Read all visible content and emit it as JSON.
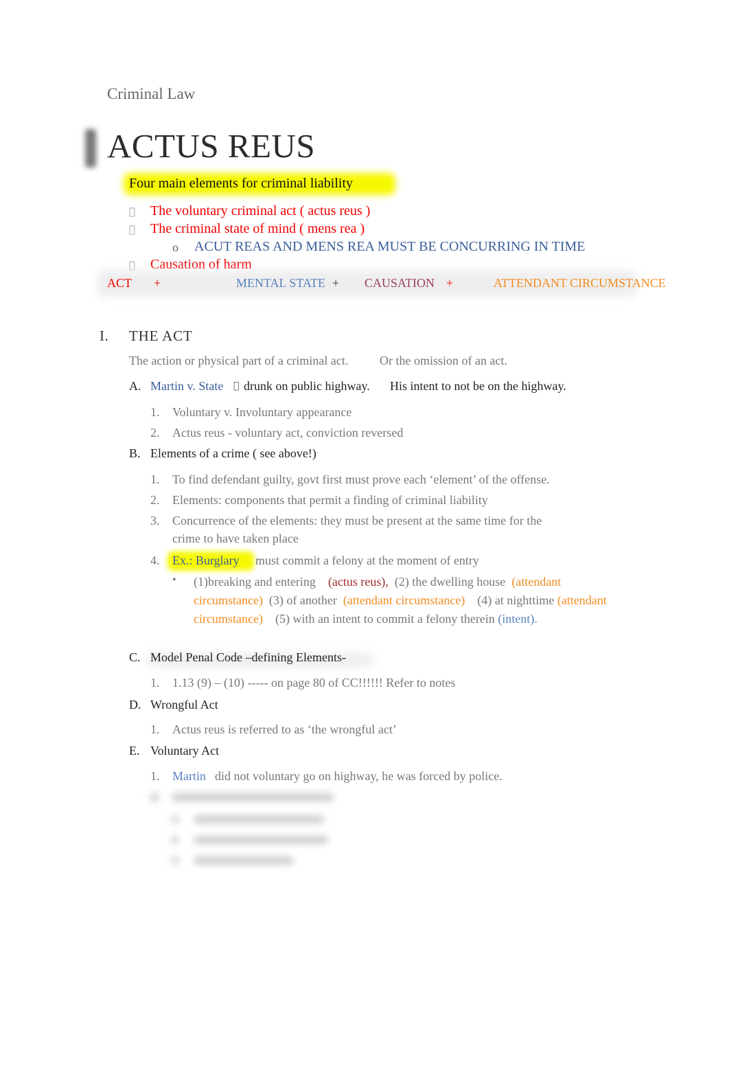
{
  "document": {
    "header": "Criminal Law",
    "title": "ACTUS REUS",
    "highlight_heading": "Four main elements for criminal liability",
    "elements": [
      {
        "bullet": "",
        "text": "The voluntary criminal act (   actus reus )"
      },
      {
        "bullet": "",
        "text": "The criminal state of mind (   mens rea )"
      },
      {
        "bullet": "",
        "text": "Causation of harm"
      }
    ],
    "sub_note": {
      "bullet": "o",
      "text": "ACUT REAS AND MENS REA MUST BE CONCURRING IN TIME"
    },
    "equation": {
      "act": "ACT",
      "plus1": "+",
      "mental_state": "MENTAL STATE",
      "plus2": "+",
      "causation": "CAUSATION",
      "plus3": "+",
      "attendant": "ATTENDANT CIRCUMSTANCE"
    },
    "section_I": {
      "numeral": "I.",
      "title": "THE ACT",
      "intro_a": "The action or physical part of a criminal act.",
      "intro_b": "Or the omission of an act.",
      "A": {
        "letter": "A.",
        "case": "Martin v. State",
        "arrow": "",
        "text_a": "drunk on public highway.",
        "text_b": "His intent to not be on the highway.",
        "items": [
          {
            "num": "1.",
            "text": "Voluntary v. Involuntary appearance"
          },
          {
            "num": "2.",
            "text": "Actus reus - voluntary act, conviction reversed"
          }
        ]
      },
      "B": {
        "letter": "B.",
        "title": "Elements of a crime ( see above!)",
        "items": [
          {
            "num": "1.",
            "text": "To find defendant guilty, govt first must prove each ‘element’ of the offense."
          },
          {
            "num": "2.",
            "text": "Elements: components that permit a finding of criminal liability"
          },
          {
            "num": "3.",
            "text_line1": "Concurrence of the elements: they must be present at the same time for the",
            "text_line2": "crime to have taken place"
          },
          {
            "num": "4.",
            "label": "Ex.: Burglary",
            "text": "must commit a felony at the moment of entry"
          }
        ],
        "burglary_bullet": {
          "bullet": "•",
          "p1": "(1)breaking and entering",
          "p1_tag": "(actus reus),",
          "p2": "(2) the dwelling house",
          "p2_tag": "(attendant circumstance)",
          "p3": "(3) of another",
          "p3_tag": "(attendant circumstance)",
          "p4": "(4) at nighttime",
          "p4_tag": "(attendant circumstance)",
          "p5": "(5) with an intent to commit a felony therein",
          "p5_tag": "(intent)."
        }
      },
      "C": {
        "letter": "C.",
        "title": "Model Penal Code –defining Elements-",
        "items": [
          {
            "num": "1.",
            "text": "1.13 (9) – (10) ----- on page 80 of CC!!!!!! Refer to notes"
          }
        ]
      },
      "D": {
        "letter": "D.",
        "title": "Wrongful Act",
        "items": [
          {
            "num": "1.",
            "text": "Actus reus is referred to as ‘the wrongful act’"
          }
        ]
      },
      "E": {
        "letter": "E.",
        "title": "Voluntary Act",
        "items": [
          {
            "num": "1.",
            "name": "Martin",
            "text": "did not voluntary go on highway, he was forced by police."
          }
        ]
      }
    }
  },
  "colors": {
    "red": "#f00000",
    "blue": "#3a5e9a",
    "light_blue": "#5a82c0",
    "maroon": "#9c3b63",
    "orange": "#f28c22",
    "highlight": "#f5f800"
  }
}
